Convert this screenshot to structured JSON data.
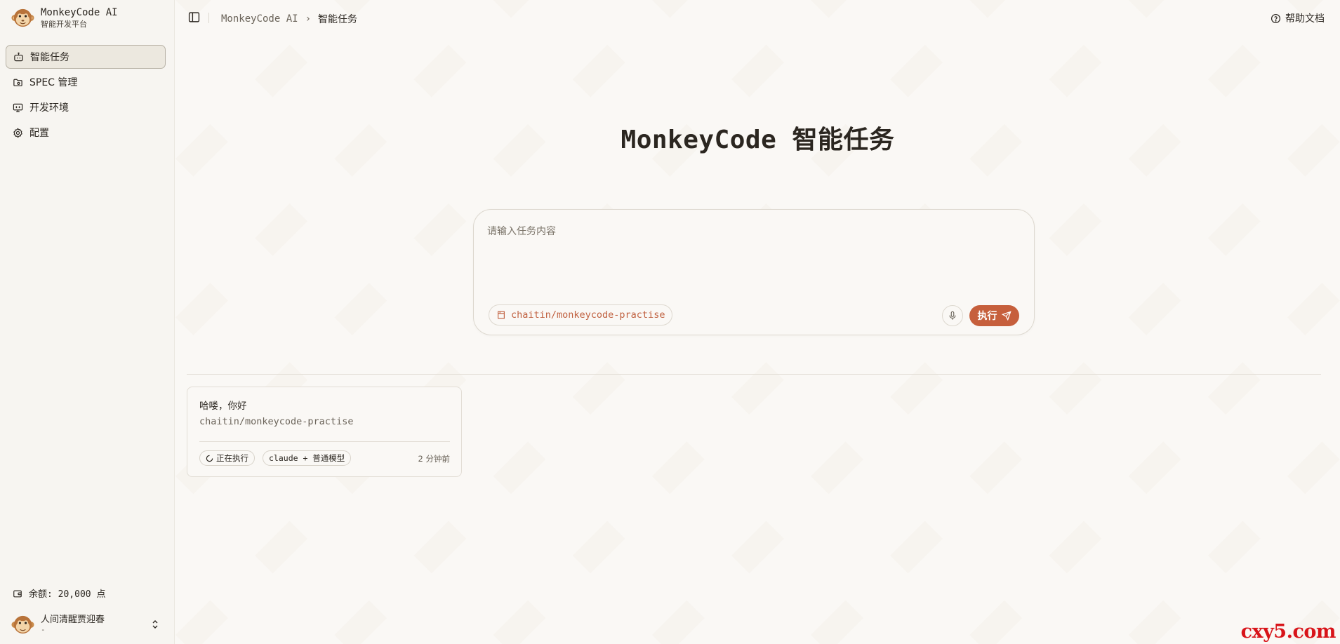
{
  "brand": {
    "name": "MonkeyCode AI",
    "subtitle": "智能开发平台"
  },
  "sidebar": {
    "items": [
      {
        "label": "智能任务",
        "icon": "bot-icon",
        "active": true
      },
      {
        "label": "SPEC 管理",
        "icon": "folder-icon",
        "active": false
      },
      {
        "label": "开发环境",
        "icon": "monitor-icon",
        "active": false
      },
      {
        "label": "配置",
        "icon": "gear-icon",
        "active": false
      }
    ],
    "balance": "余额: 20,000 点",
    "user": {
      "name": "人间清醒贾迎春",
      "sub": "-"
    }
  },
  "header": {
    "breadcrumb": [
      "MonkeyCode AI",
      "智能任务"
    ],
    "breadcrumb_sep": "›",
    "help": "帮助文档"
  },
  "main": {
    "title": "MonkeyCode 智能任务",
    "composer": {
      "placeholder": "请输入任务内容",
      "repo": "chaitin/monkeycode-practise",
      "run_label": "执行"
    },
    "tasks": [
      {
        "title": "哈喽，你好",
        "repo": "chaitin/monkeycode-practise",
        "status": "正在执行",
        "model": "claude + 普通模型",
        "time": "2 分钟前"
      }
    ]
  },
  "watermark": "cxy5.com",
  "colors": {
    "accent": "#c65f3c",
    "background": "#faf8f5",
    "watermark": "#d8141a"
  }
}
